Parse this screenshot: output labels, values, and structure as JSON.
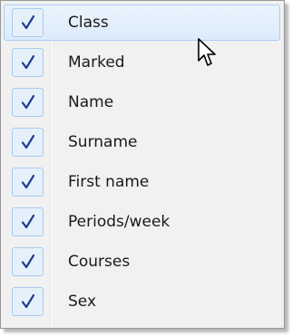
{
  "menu": {
    "items": [
      {
        "label": "Class",
        "checked": true,
        "hovered": true
      },
      {
        "label": "Marked",
        "checked": true
      },
      {
        "label": "Name",
        "checked": true
      },
      {
        "label": "Surname",
        "checked": true
      },
      {
        "label": "First name",
        "checked": true
      },
      {
        "label": "Periods/week",
        "checked": true
      },
      {
        "label": "Courses",
        "checked": true
      },
      {
        "label": "Sex",
        "checked": true
      }
    ]
  },
  "icons": {
    "check": "check-icon",
    "cursor": "mouse-pointer-icon"
  },
  "colors": {
    "menu_background": "#f1f1f1",
    "hover_border": "#a8cef4",
    "checkbox_background": "#e6f0fa",
    "check_mark": "#1e3c8c"
  }
}
